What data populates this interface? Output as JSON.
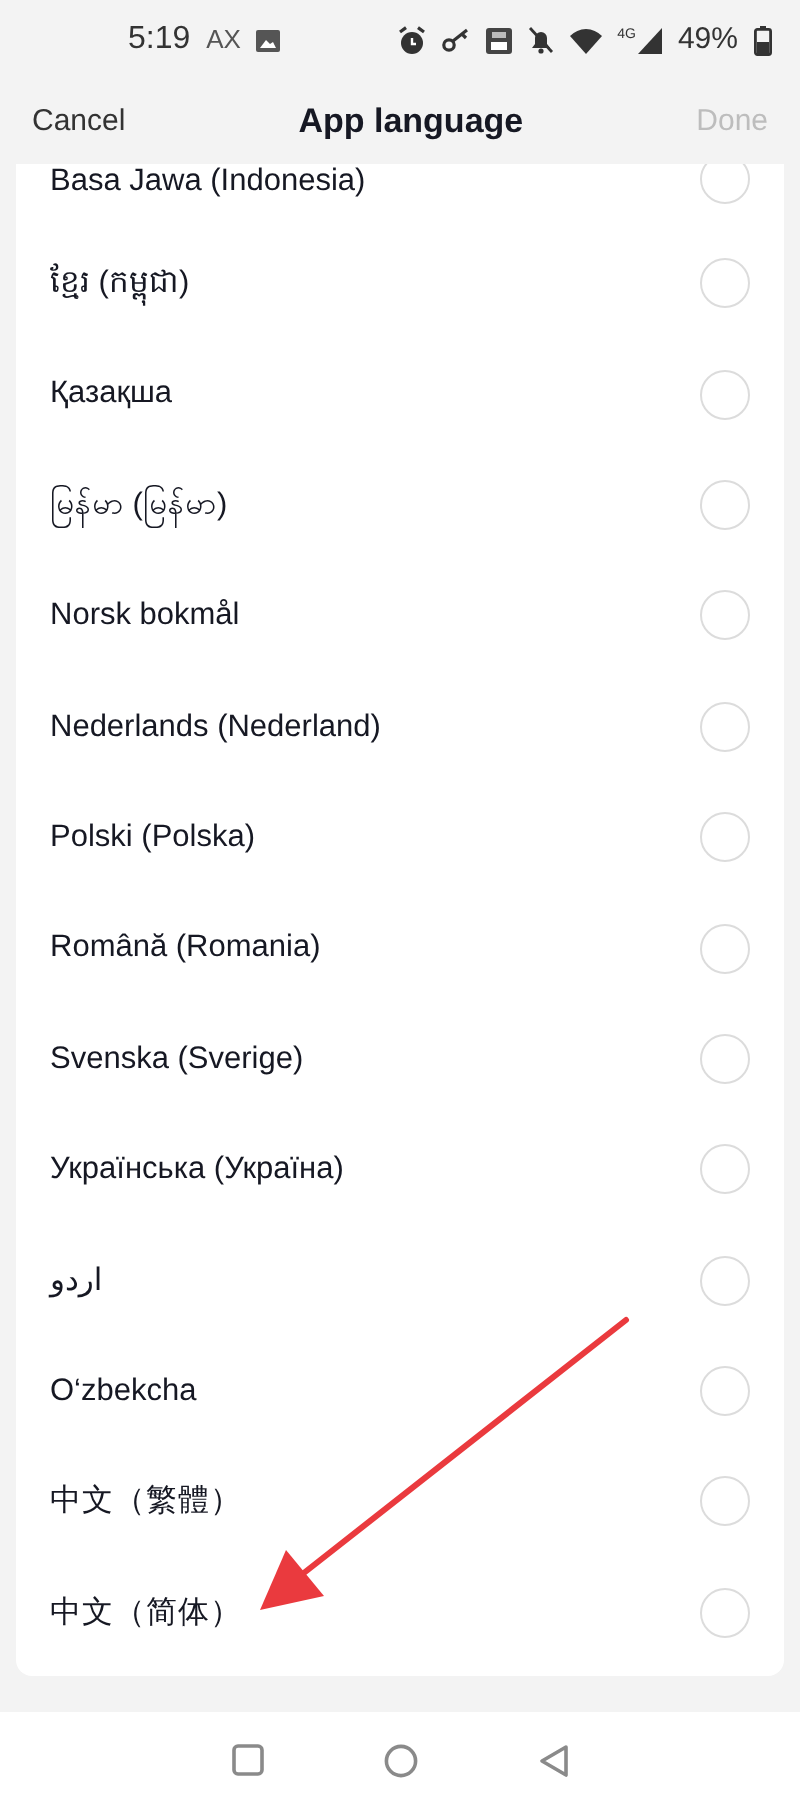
{
  "status_bar": {
    "time": "5:19",
    "carrier": "AX",
    "network": "4G",
    "battery": "49%"
  },
  "header": {
    "cancel": "Cancel",
    "title": "App language",
    "done": "Done",
    "done_disabled": true
  },
  "languages": [
    {
      "label": "Basa Jawa (Indonesia)",
      "selected": false
    },
    {
      "label": "ខ្មែរ (កម្ពុជា)",
      "selected": false
    },
    {
      "label": "Қазақша",
      "selected": false
    },
    {
      "label": "မြန်မာ (မြန်မာ)",
      "selected": false
    },
    {
      "label": "Norsk bokmål",
      "selected": false
    },
    {
      "label": "Nederlands (Nederland)",
      "selected": false
    },
    {
      "label": "Polski (Polska)",
      "selected": false
    },
    {
      "label": "Română (Romania)",
      "selected": false
    },
    {
      "label": "Svenska (Sverige)",
      "selected": false
    },
    {
      "label": "Українська (Україна)",
      "selected": false
    },
    {
      "label": "اردو",
      "selected": false
    },
    {
      "label": "O‘zbekcha",
      "selected": false
    },
    {
      "label": "中文（繁體）",
      "selected": false
    },
    {
      "label": "中文（简体）",
      "selected": false
    }
  ]
}
